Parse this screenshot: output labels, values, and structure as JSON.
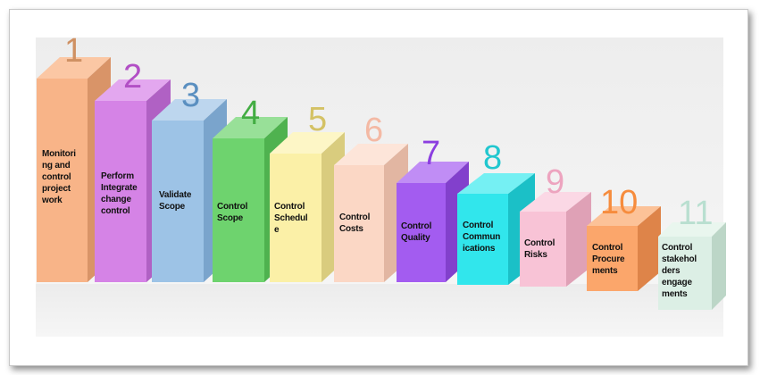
{
  "steps": [
    {
      "number": "1",
      "label": "Monitori\nng and\ncontrol\nproject\nwork",
      "front": "#f8b488",
      "side": "#d99468",
      "top": "#fbc7a4",
      "num_color": "#cf9163"
    },
    {
      "number": "2",
      "label": "Perform\nIntegrate\nchange\ncontrol",
      "front": "#d583e6",
      "side": "#b061c4",
      "top": "#e3a7ef",
      "num_color": "#b24fc5"
    },
    {
      "number": "3",
      "label": "Validate\nScope",
      "front": "#9dc3e6",
      "side": "#7aa4cc",
      "top": "#bdd6ee",
      "num_color": "#5a8fc0"
    },
    {
      "number": "4",
      "label": "Control\nScope",
      "front": "#6ed36e",
      "side": "#4fb24f",
      "top": "#98e098",
      "num_color": "#43ad43"
    },
    {
      "number": "5",
      "label": "Control\nSchedul\ne",
      "front": "#fbf0a7",
      "side": "#d9cc7e",
      "top": "#fdf6c6",
      "num_color": "#d4c265"
    },
    {
      "number": "6",
      "label": "Control\nCosts",
      "front": "#fbd7c5",
      "side": "#e2b6a2",
      "top": "#fde5d9",
      "num_color": "#f4b9a4"
    },
    {
      "number": "7",
      "label": "Control\nQuality",
      "front": "#a35cf0",
      "side": "#8240cc",
      "top": "#c08df5",
      "num_color": "#8c3fe0"
    },
    {
      "number": "8",
      "label": "Control\nCommun\nications",
      "front": "#31e6ec",
      "side": "#1bc0c7",
      "top": "#75f0f3",
      "num_color": "#21c7cf"
    },
    {
      "number": "9",
      "label": "Control\nRisks",
      "front": "#f8c3d6",
      "side": "#dfa1b6",
      "top": "#fbd8e5",
      "num_color": "#eda4bf"
    },
    {
      "number": "10",
      "label": "Control\nProcure\nments",
      "front": "#fba66b",
      "side": "#de8449",
      "top": "#fcc298",
      "num_color": "#f68c3d"
    },
    {
      "number": "11",
      "label": "Control\nstakehol\nders\nengage\nments",
      "front": "#dcefe5",
      "side": "#bcd6c7",
      "top": "#e9f6ee",
      "num_color": "#b9dfd0"
    }
  ]
}
